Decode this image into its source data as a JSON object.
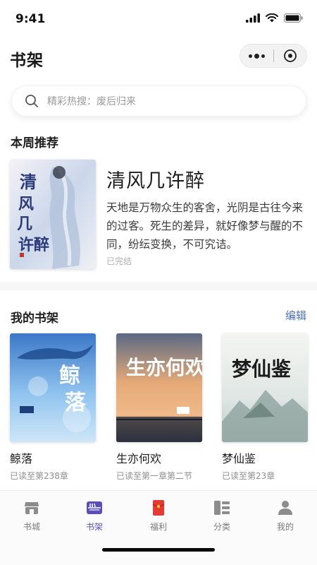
{
  "status_bar": {
    "time": "9:41"
  },
  "header": {
    "title": "书架"
  },
  "search": {
    "placeholder": "精彩热搜：废后归来"
  },
  "weekly": {
    "title": "本周推荐",
    "book": {
      "title": "清风几许醉",
      "description": "天地是万物众生的客舍，光阴是古往今来的过客。死生的差异，就好像梦与醒的不同，纷纭变换，不可究诘。",
      "status": "已完结"
    }
  },
  "shelf": {
    "title": "我的书架",
    "edit_label": "编辑",
    "books": [
      {
        "title": "鲸落",
        "progress": "已读至第238章"
      },
      {
        "title": "生亦何欢",
        "progress": "已读至第一章第二节"
      },
      {
        "title": "梦仙鉴",
        "progress": "已读至第23章"
      }
    ]
  },
  "tabs": [
    {
      "label": "书城",
      "icon": "store-icon"
    },
    {
      "label": "书架",
      "icon": "bookshelf-icon",
      "active": true
    },
    {
      "label": "福利",
      "icon": "red-envelope-icon"
    },
    {
      "label": "分类",
      "icon": "category-icon"
    },
    {
      "label": "我的",
      "icon": "profile-icon"
    }
  ],
  "colors": {
    "accent": "#5a4fb8",
    "link": "#4f6fc2",
    "red_envelope": "#e53935"
  }
}
